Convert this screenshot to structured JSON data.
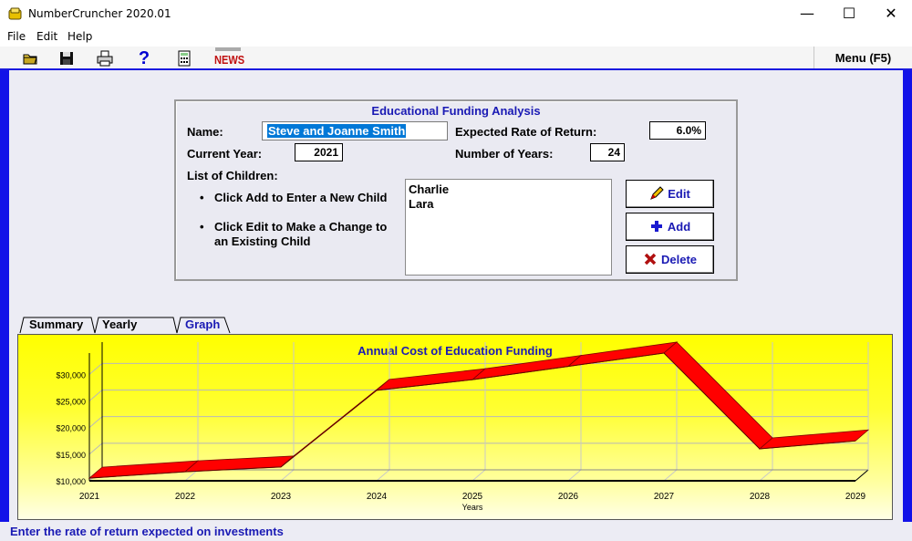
{
  "window": {
    "title": "NumberCruncher 2020.01",
    "minimize": "—",
    "maximize": "☐",
    "close": "✕"
  },
  "menu": {
    "file": "File",
    "edit": "Edit",
    "help": "Help"
  },
  "toolbar": {
    "news": "NEWS",
    "help_icon": "?",
    "menu_button": "Menu (F5)"
  },
  "form": {
    "title": "Educational Funding Analysis",
    "name_label": "Name:",
    "name_value": "Steve and Joanne Smith",
    "rate_label": "Expected Rate of Return:",
    "rate_value": "6.0%",
    "current_year_label": "Current Year:",
    "current_year_value": "2021",
    "num_years_label": "Number of Years:",
    "num_years_value": "24",
    "children_label": "List of Children:",
    "bullet1": "Click Add to Enter a New Child",
    "bullet2_line1": "Click Edit to Make a Change to",
    "bullet2_line2": "an Existing Child",
    "children": [
      "Charlie",
      "Lara"
    ],
    "edit_button": "Edit",
    "add_button": "Add",
    "delete_button": "Delete"
  },
  "tabs": {
    "summary": "Summary",
    "yearly_cost": "Yearly Cost",
    "graph": "Graph"
  },
  "chart_data": {
    "type": "line",
    "title": "Annual Cost of Education Funding",
    "xlabel": "Years",
    "ylabel": "",
    "x": [
      "2021",
      "2022",
      "2023",
      "2024",
      "2025",
      "2026",
      "2027",
      "2028",
      "2029"
    ],
    "values": [
      10500,
      11700,
      12600,
      27000,
      29000,
      31500,
      34000,
      16000,
      17500
    ],
    "yticks": [
      "$10,000",
      "$15,000",
      "$20,000",
      "$25,000",
      "$30,000"
    ],
    "ylim": [
      10000,
      34000
    ],
    "grid": true,
    "style": "3d-ribbon",
    "series_color": "#ff0000",
    "background": "#ffff00"
  },
  "status": {
    "text": "Enter the rate of return expected on investments"
  },
  "colors": {
    "accent": "#1a1ab4",
    "frame": "#1212e8",
    "selection": "#0078d7"
  }
}
